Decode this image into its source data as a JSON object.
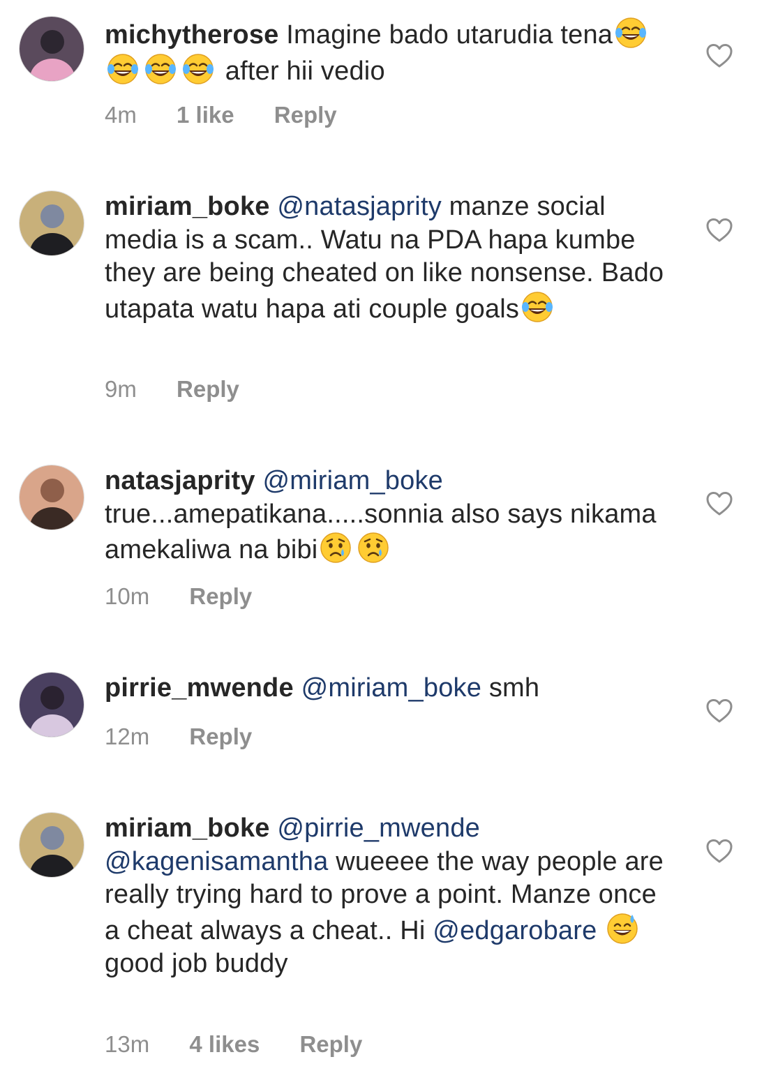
{
  "comments": [
    {
      "username": "michytherose",
      "avatar_colors": [
        "#5a4a5c",
        "#e8a3c4",
        "#2c2630"
      ],
      "time": "4m",
      "likes": "1 like",
      "reply": "Reply",
      "text_parts": [
        {
          "t": "text",
          "v": " Imagine bado utarudia tena"
        },
        {
          "t": "emoji",
          "icon": "tears-of-joy-emoji"
        },
        {
          "t": "emoji",
          "icon": "tears-of-joy-emoji"
        },
        {
          "t": "emoji",
          "icon": "tears-of-joy-emoji"
        },
        {
          "t": "emoji",
          "icon": "tears-of-joy-emoji"
        },
        {
          "t": "text",
          "v": " after hii vedio"
        }
      ]
    },
    {
      "username": "miriam_boke",
      "avatar_colors": [
        "#c8b07a",
        "#1e1e22",
        "#7f89a0"
      ],
      "time": "9m",
      "likes": "",
      "reply": "Reply",
      "text_parts": [
        {
          "t": "text",
          "v": " "
        },
        {
          "t": "mention",
          "v": "@natasjaprity"
        },
        {
          "t": "text",
          "v": " manze social media is a scam.. Watu na PDA hapa kumbe they are being cheated on like nonsense. Bado utapata watu hapa ati couple goals"
        },
        {
          "t": "emoji",
          "icon": "tears-of-joy-emoji"
        }
      ]
    },
    {
      "username": "natasjaprity",
      "avatar_colors": [
        "#d9a58a",
        "#3a2a24",
        "#8f5f4a"
      ],
      "time": "10m",
      "likes": "",
      "reply": "Reply",
      "text_parts": [
        {
          "t": "text",
          "v": " "
        },
        {
          "t": "mention",
          "v": "@miriam_boke"
        },
        {
          "t": "text",
          "v": " true...amepatikana.....sonnia also says nikama amekaliwa na bibi"
        },
        {
          "t": "emoji",
          "icon": "crying-face-emoji"
        },
        {
          "t": "emoji",
          "icon": "crying-face-emoji"
        }
      ]
    },
    {
      "username": "pirrie_mwende",
      "avatar_colors": [
        "#4a4060",
        "#d8c8e0",
        "#2a2230"
      ],
      "time": "12m",
      "likes": "",
      "reply": "Reply",
      "text_parts": [
        {
          "t": "text",
          "v": " "
        },
        {
          "t": "mention",
          "v": "@miriam_boke"
        },
        {
          "t": "text",
          "v": " smh"
        }
      ]
    },
    {
      "username": "miriam_boke",
      "avatar_colors": [
        "#c8b07a",
        "#1e1e22",
        "#7f89a0"
      ],
      "time": "13m",
      "likes": "4 likes",
      "reply": "Reply",
      "text_parts": [
        {
          "t": "text",
          "v": " "
        },
        {
          "t": "mention",
          "v": "@pirrie_mwende"
        },
        {
          "t": "text",
          "v": " "
        },
        {
          "t": "mention",
          "v": "@kagenisamantha"
        },
        {
          "t": "text",
          "v": " wueeee the way people are really trying hard to prove a point. Manze once a cheat always a cheat.. Hi "
        },
        {
          "t": "mention",
          "v": "@edgarobare"
        },
        {
          "t": "text",
          "v": " "
        },
        {
          "t": "emoji",
          "icon": "grinning-sweat-emoji"
        },
        {
          "t": "text",
          "v": "good job buddy"
        }
      ]
    }
  ]
}
